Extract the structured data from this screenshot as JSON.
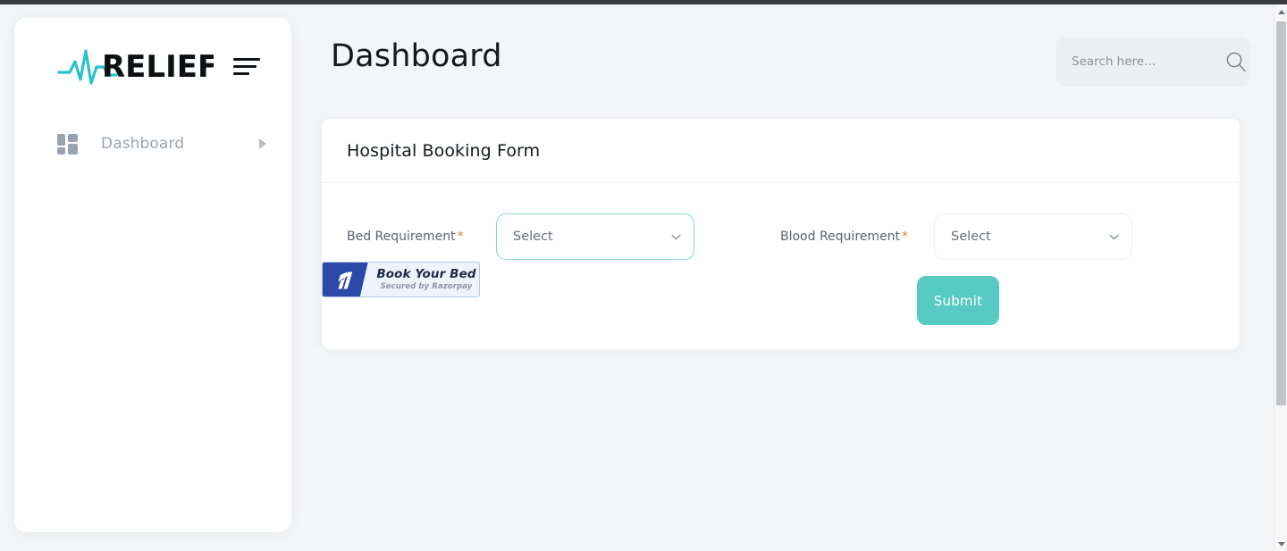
{
  "brand": {
    "name": "RELIEF.",
    "pulse_color": "#29c3c9",
    "wordmark_color": "#0d0f12"
  },
  "sidebar": {
    "menu_toggle_name": "hamburger-menu",
    "items": [
      {
        "label": "Dashboard",
        "icon": "grid-dashboard-icon",
        "expand_icon": "caret-right-icon",
        "active": false
      }
    ]
  },
  "topbar": {
    "title": "Dashboard",
    "search": {
      "placeholder": "Search here...",
      "value": "",
      "icon": "search-icon"
    }
  },
  "card": {
    "title": "Hospital Booking Form",
    "fields": [
      {
        "label": "Bed Requirement",
        "required_marker": "*",
        "value": "Select",
        "focused": true,
        "chevron": "chevron-down-icon"
      },
      {
        "label": "Blood Requirement",
        "required_marker": "*",
        "value": "Select",
        "focused": false,
        "chevron": "chevron-down-icon"
      }
    ],
    "submit_label": "Submit",
    "submit_color": "#57cbc3"
  },
  "razorpay_badge": {
    "title": "Book Your Bed",
    "subtitle": "Secured by Razorpay",
    "logo_icon": "razorpay-logo-icon",
    "brand_color": "#2b4aa8"
  },
  "scrollbar": {
    "up_arrow": "scroll-up-arrow-icon",
    "down_arrow": "scroll-down-arrow-icon"
  }
}
